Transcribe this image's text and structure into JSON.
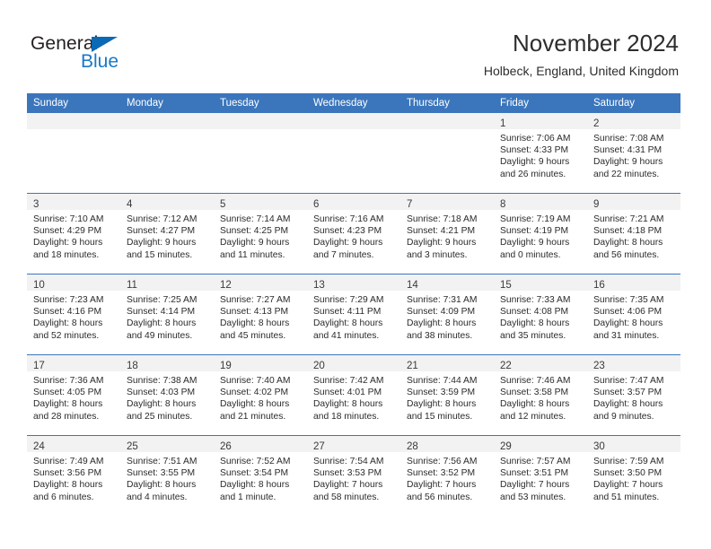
{
  "brand": {
    "name_part1": "General",
    "name_part2": "Blue",
    "triangle_color": "#0b6ab5",
    "blue_color": "#1878c8"
  },
  "header": {
    "title": "November 2024",
    "subtitle": "Holbeck, England, United Kingdom"
  },
  "theme": {
    "header_blue": "#3b76bc",
    "daynum_band": "#f2f2f2",
    "text": "#2b2b2b"
  },
  "calendar": {
    "weekday_headers": [
      "Sunday",
      "Monday",
      "Tuesday",
      "Wednesday",
      "Thursday",
      "Friday",
      "Saturday"
    ],
    "weeks": [
      [
        {
          "day": "",
          "empty": true
        },
        {
          "day": "",
          "empty": true
        },
        {
          "day": "",
          "empty": true
        },
        {
          "day": "",
          "empty": true
        },
        {
          "day": "",
          "empty": true
        },
        {
          "day": "1",
          "sunrise": "Sunrise: 7:06 AM",
          "sunset": "Sunset: 4:33 PM",
          "daylight1": "Daylight: 9 hours",
          "daylight2": "and 26 minutes."
        },
        {
          "day": "2",
          "sunrise": "Sunrise: 7:08 AM",
          "sunset": "Sunset: 4:31 PM",
          "daylight1": "Daylight: 9 hours",
          "daylight2": "and 22 minutes."
        }
      ],
      [
        {
          "day": "3",
          "sunrise": "Sunrise: 7:10 AM",
          "sunset": "Sunset: 4:29 PM",
          "daylight1": "Daylight: 9 hours",
          "daylight2": "and 18 minutes."
        },
        {
          "day": "4",
          "sunrise": "Sunrise: 7:12 AM",
          "sunset": "Sunset: 4:27 PM",
          "daylight1": "Daylight: 9 hours",
          "daylight2": "and 15 minutes."
        },
        {
          "day": "5",
          "sunrise": "Sunrise: 7:14 AM",
          "sunset": "Sunset: 4:25 PM",
          "daylight1": "Daylight: 9 hours",
          "daylight2": "and 11 minutes."
        },
        {
          "day": "6",
          "sunrise": "Sunrise: 7:16 AM",
          "sunset": "Sunset: 4:23 PM",
          "daylight1": "Daylight: 9 hours",
          "daylight2": "and 7 minutes."
        },
        {
          "day": "7",
          "sunrise": "Sunrise: 7:18 AM",
          "sunset": "Sunset: 4:21 PM",
          "daylight1": "Daylight: 9 hours",
          "daylight2": "and 3 minutes."
        },
        {
          "day": "8",
          "sunrise": "Sunrise: 7:19 AM",
          "sunset": "Sunset: 4:19 PM",
          "daylight1": "Daylight: 9 hours",
          "daylight2": "and 0 minutes."
        },
        {
          "day": "9",
          "sunrise": "Sunrise: 7:21 AM",
          "sunset": "Sunset: 4:18 PM",
          "daylight1": "Daylight: 8 hours",
          "daylight2": "and 56 minutes."
        }
      ],
      [
        {
          "day": "10",
          "sunrise": "Sunrise: 7:23 AM",
          "sunset": "Sunset: 4:16 PM",
          "daylight1": "Daylight: 8 hours",
          "daylight2": "and 52 minutes."
        },
        {
          "day": "11",
          "sunrise": "Sunrise: 7:25 AM",
          "sunset": "Sunset: 4:14 PM",
          "daylight1": "Daylight: 8 hours",
          "daylight2": "and 49 minutes."
        },
        {
          "day": "12",
          "sunrise": "Sunrise: 7:27 AM",
          "sunset": "Sunset: 4:13 PM",
          "daylight1": "Daylight: 8 hours",
          "daylight2": "and 45 minutes."
        },
        {
          "day": "13",
          "sunrise": "Sunrise: 7:29 AM",
          "sunset": "Sunset: 4:11 PM",
          "daylight1": "Daylight: 8 hours",
          "daylight2": "and 41 minutes."
        },
        {
          "day": "14",
          "sunrise": "Sunrise: 7:31 AM",
          "sunset": "Sunset: 4:09 PM",
          "daylight1": "Daylight: 8 hours",
          "daylight2": "and 38 minutes."
        },
        {
          "day": "15",
          "sunrise": "Sunrise: 7:33 AM",
          "sunset": "Sunset: 4:08 PM",
          "daylight1": "Daylight: 8 hours",
          "daylight2": "and 35 minutes."
        },
        {
          "day": "16",
          "sunrise": "Sunrise: 7:35 AM",
          "sunset": "Sunset: 4:06 PM",
          "daylight1": "Daylight: 8 hours",
          "daylight2": "and 31 minutes."
        }
      ],
      [
        {
          "day": "17",
          "sunrise": "Sunrise: 7:36 AM",
          "sunset": "Sunset: 4:05 PM",
          "daylight1": "Daylight: 8 hours",
          "daylight2": "and 28 minutes."
        },
        {
          "day": "18",
          "sunrise": "Sunrise: 7:38 AM",
          "sunset": "Sunset: 4:03 PM",
          "daylight1": "Daylight: 8 hours",
          "daylight2": "and 25 minutes."
        },
        {
          "day": "19",
          "sunrise": "Sunrise: 7:40 AM",
          "sunset": "Sunset: 4:02 PM",
          "daylight1": "Daylight: 8 hours",
          "daylight2": "and 21 minutes."
        },
        {
          "day": "20",
          "sunrise": "Sunrise: 7:42 AM",
          "sunset": "Sunset: 4:01 PM",
          "daylight1": "Daylight: 8 hours",
          "daylight2": "and 18 minutes."
        },
        {
          "day": "21",
          "sunrise": "Sunrise: 7:44 AM",
          "sunset": "Sunset: 3:59 PM",
          "daylight1": "Daylight: 8 hours",
          "daylight2": "and 15 minutes."
        },
        {
          "day": "22",
          "sunrise": "Sunrise: 7:46 AM",
          "sunset": "Sunset: 3:58 PM",
          "daylight1": "Daylight: 8 hours",
          "daylight2": "and 12 minutes."
        },
        {
          "day": "23",
          "sunrise": "Sunrise: 7:47 AM",
          "sunset": "Sunset: 3:57 PM",
          "daylight1": "Daylight: 8 hours",
          "daylight2": "and 9 minutes."
        }
      ],
      [
        {
          "day": "24",
          "sunrise": "Sunrise: 7:49 AM",
          "sunset": "Sunset: 3:56 PM",
          "daylight1": "Daylight: 8 hours",
          "daylight2": "and 6 minutes."
        },
        {
          "day": "25",
          "sunrise": "Sunrise: 7:51 AM",
          "sunset": "Sunset: 3:55 PM",
          "daylight1": "Daylight: 8 hours",
          "daylight2": "and 4 minutes."
        },
        {
          "day": "26",
          "sunrise": "Sunrise: 7:52 AM",
          "sunset": "Sunset: 3:54 PM",
          "daylight1": "Daylight: 8 hours",
          "daylight2": "and 1 minute."
        },
        {
          "day": "27",
          "sunrise": "Sunrise: 7:54 AM",
          "sunset": "Sunset: 3:53 PM",
          "daylight1": "Daylight: 7 hours",
          "daylight2": "and 58 minutes."
        },
        {
          "day": "28",
          "sunrise": "Sunrise: 7:56 AM",
          "sunset": "Sunset: 3:52 PM",
          "daylight1": "Daylight: 7 hours",
          "daylight2": "and 56 minutes."
        },
        {
          "day": "29",
          "sunrise": "Sunrise: 7:57 AM",
          "sunset": "Sunset: 3:51 PM",
          "daylight1": "Daylight: 7 hours",
          "daylight2": "and 53 minutes."
        },
        {
          "day": "30",
          "sunrise": "Sunrise: 7:59 AM",
          "sunset": "Sunset: 3:50 PM",
          "daylight1": "Daylight: 7 hours",
          "daylight2": "and 51 minutes."
        }
      ]
    ]
  }
}
